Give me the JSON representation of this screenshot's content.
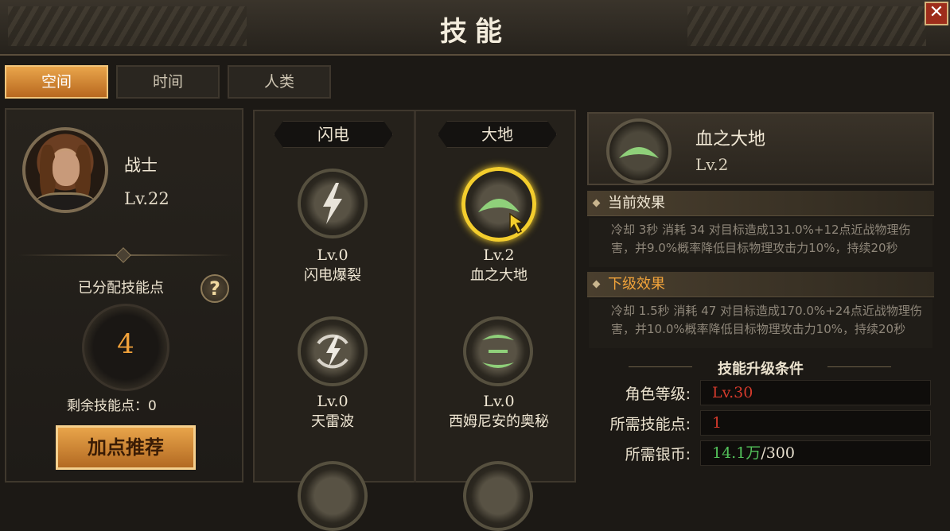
{
  "window": {
    "title": "技能",
    "close_label": "✕"
  },
  "tabs": [
    {
      "label": "空间",
      "active": true
    },
    {
      "label": "时间",
      "active": false
    },
    {
      "label": "人类",
      "active": false
    }
  ],
  "character": {
    "name": "战士",
    "level": "Lv.22",
    "allocated_label": "已分配技能点",
    "help_label": "?",
    "allocated_points": "4",
    "remaining_label": "剩余技能点：0",
    "recommend_button": "加点推荐"
  },
  "tree": {
    "columns": [
      {
        "header": "闪电"
      },
      {
        "header": "大地"
      }
    ],
    "skills": [
      {
        "level": "Lv.0",
        "name": "闪电爆裂",
        "icon": "lightning-icon"
      },
      {
        "level": "Lv.2",
        "name": "血之大地",
        "icon": "crescent-icon",
        "selected": true
      },
      {
        "level": "Lv.0",
        "name": "天雷波",
        "icon": "thunder-wave-icon"
      },
      {
        "level": "Lv.0",
        "name": "西姆尼安的奥秘",
        "icon": "arc-pair-icon"
      }
    ]
  },
  "detail": {
    "name": "血之大地",
    "level": "Lv.2",
    "current_title": "当前效果",
    "current_text": "冷却 3秒 消耗 34 对目标造成131.0%+12点近战物理伤害，并9.0%概率降低目标物理攻击力10%，持续20秒",
    "next_title": "下级效果",
    "next_text": "冷却 1.5秒 消耗 47 对目标造成170.0%+24点近战物理伤害，并10.0%概率降低目标物理攻击力10%，持续20秒"
  },
  "requirements": {
    "title": "技能升级条件",
    "rows": [
      {
        "label": "角色等级:",
        "value": "Lv.30"
      },
      {
        "label": "所需技能点:",
        "value": "1"
      },
      {
        "label": "所需银币:",
        "value_have": "14.1万",
        "value_need": "/300"
      }
    ]
  },
  "colors": {
    "accent_orange": "#f0a13a",
    "selected_ring": "#f3cd2d",
    "requirement_unmet": "#d43a2c",
    "requirement_met": "#53c15a",
    "skill_green": "#8fd07a"
  }
}
